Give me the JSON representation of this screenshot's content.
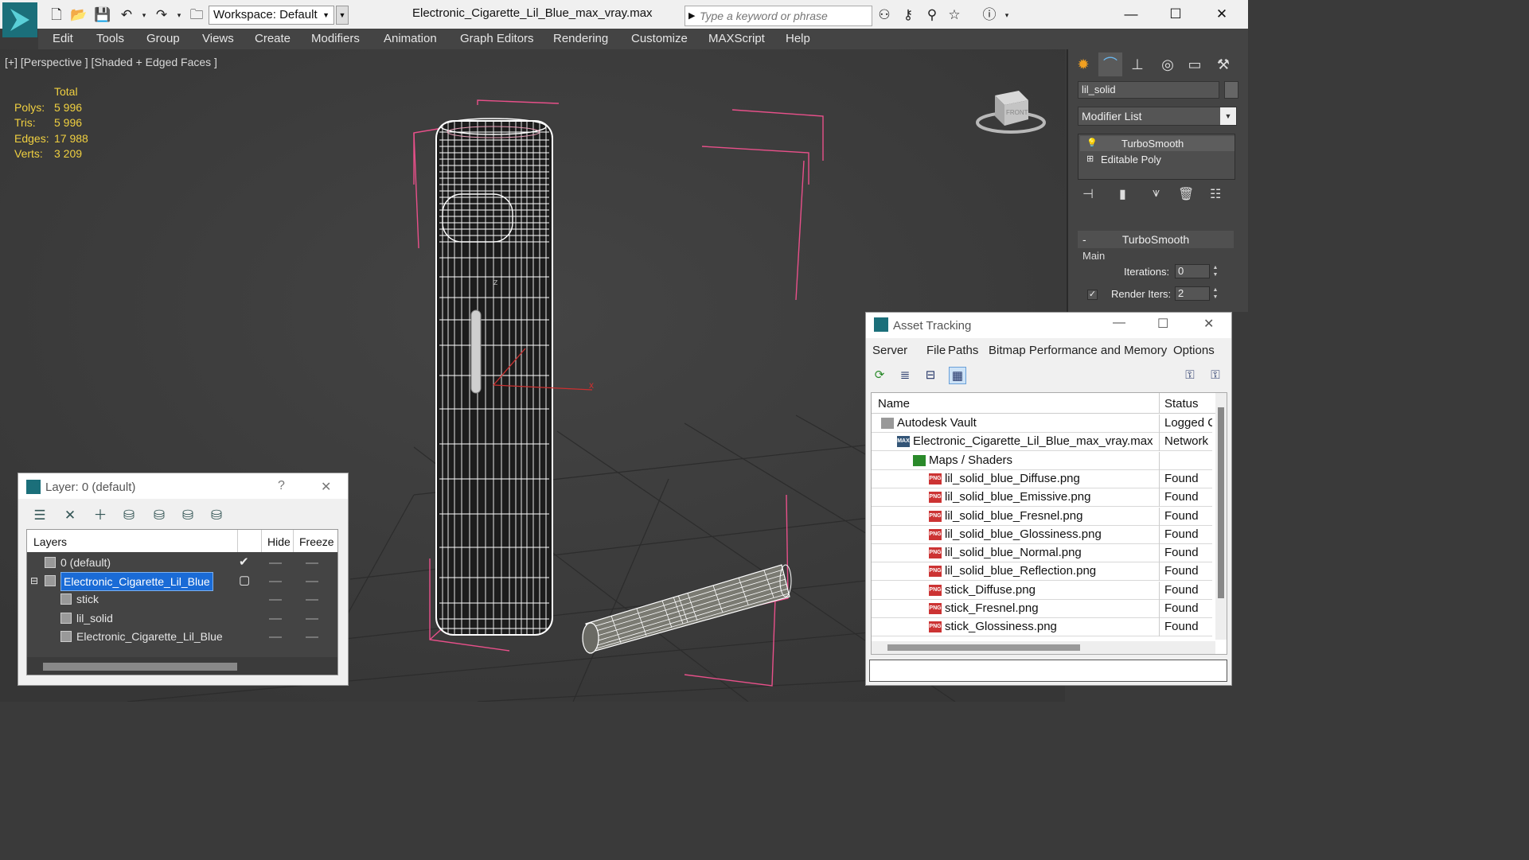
{
  "titlebar": {
    "workspace": "Workspace: Default",
    "file_title": "Electronic_Cigarette_Lil_Blue_max_vray.max",
    "search_placeholder": "Type a keyword or phrase"
  },
  "menu": [
    "Edit",
    "Tools",
    "Group",
    "Views",
    "Create",
    "Modifiers",
    "Animation",
    "Graph Editors",
    "Rendering",
    "Customize",
    "MAXScript",
    "Help"
  ],
  "viewport": {
    "label": "[+] [Perspective ] [Shaded + Edged Faces ]",
    "stats_header": "Total",
    "stats": [
      {
        "label": "Polys:",
        "value": "5 996"
      },
      {
        "label": "Tris:",
        "value": "5 996"
      },
      {
        "label": "Edges:",
        "value": "17 988"
      },
      {
        "label": "Verts:",
        "value": "3 209"
      }
    ],
    "axis_x": "x",
    "axis_z": "z",
    "viewcube_label": "FRONT"
  },
  "command_panel": {
    "object_name": "lil_solid",
    "modifier_list": "Modifier List",
    "stack": [
      "TurboSmooth",
      "Editable Poly"
    ],
    "rollout_title": "TurboSmooth",
    "group_main": "Main",
    "iterations_label": "Iterations:",
    "iterations_value": "0",
    "render_iters_label": "Render Iters:",
    "render_iters_value": "2"
  },
  "asset_tracking": {
    "title": "Asset Tracking",
    "menu": [
      "Server",
      "File",
      "Paths",
      "Bitmap Performance and Memory",
      "Options"
    ],
    "col_name": "Name",
    "col_status": "Status",
    "rows": [
      {
        "name": "Autodesk Vault",
        "status": "Logged C",
        "indent": 0,
        "icon": "vault"
      },
      {
        "name": "Electronic_Cigarette_Lil_Blue_max_vray.max",
        "status": "Network",
        "indent": 1,
        "icon": "max"
      },
      {
        "name": "Maps / Shaders",
        "status": "",
        "indent": 2,
        "icon": "folder"
      },
      {
        "name": "lil_solid_blue_Diffuse.png",
        "status": "Found",
        "indent": 3,
        "icon": "png"
      },
      {
        "name": "lil_solid_blue_Emissive.png",
        "status": "Found",
        "indent": 3,
        "icon": "png"
      },
      {
        "name": "lil_solid_blue_Fresnel.png",
        "status": "Found",
        "indent": 3,
        "icon": "png"
      },
      {
        "name": "lil_solid_blue_Glossiness.png",
        "status": "Found",
        "indent": 3,
        "icon": "png"
      },
      {
        "name": "lil_solid_blue_Normal.png",
        "status": "Found",
        "indent": 3,
        "icon": "png"
      },
      {
        "name": "lil_solid_blue_Reflection.png",
        "status": "Found",
        "indent": 3,
        "icon": "png"
      },
      {
        "name": "stick_Diffuse.png",
        "status": "Found",
        "indent": 3,
        "icon": "png"
      },
      {
        "name": "stick_Fresnel.png",
        "status": "Found",
        "indent": 3,
        "icon": "png"
      },
      {
        "name": "stick_Glossiness.png",
        "status": "Found",
        "indent": 3,
        "icon": "png"
      }
    ]
  },
  "layer_explorer": {
    "title": "Layer: 0 (default)",
    "help": "?",
    "col_layers": "Layers",
    "col_hide": "Hide",
    "col_freeze": "Freeze",
    "rows": [
      {
        "name": "0 (default)",
        "indent": 1,
        "type": "layer",
        "active": true,
        "selected": false
      },
      {
        "name": "Electronic_Cigarette_Lil_Blue",
        "indent": 1,
        "type": "layer",
        "active": false,
        "selected": true
      },
      {
        "name": "stick",
        "indent": 2,
        "type": "object",
        "active": false,
        "selected": false
      },
      {
        "name": "lil_solid",
        "indent": 2,
        "type": "object",
        "active": false,
        "selected": false
      },
      {
        "name": "Electronic_Cigarette_Lil_Blue",
        "indent": 2,
        "type": "object",
        "active": false,
        "selected": false
      }
    ]
  },
  "colors": {
    "wireframe": "#ffffff",
    "bbox": "#e8508a",
    "stats": "#f0d040",
    "selection": "#1a6bd6"
  }
}
